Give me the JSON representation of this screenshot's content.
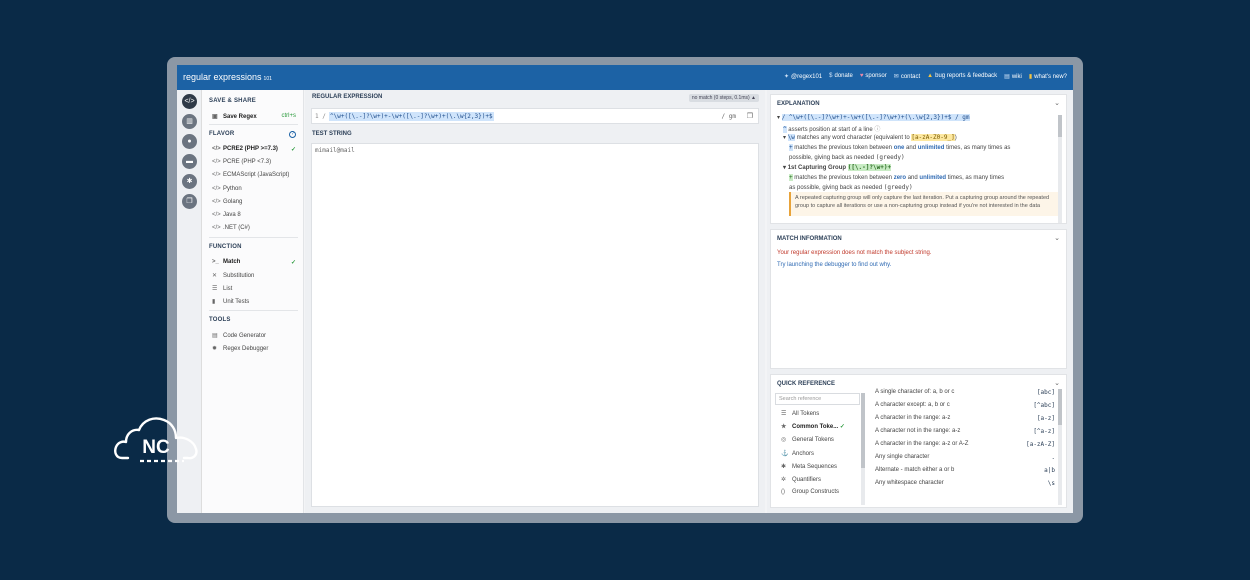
{
  "app": {
    "name": "regular expressions",
    "version": "101"
  },
  "topnav": [
    {
      "icon": "twitter-icon",
      "label": "@regex101"
    },
    {
      "icon": "dollar-icon",
      "label": "donate"
    },
    {
      "icon": "heart-icon",
      "label": "sponsor"
    },
    {
      "icon": "mail-icon",
      "label": "contact"
    },
    {
      "icon": "warning-icon",
      "label": "bug reports & feedback"
    },
    {
      "icon": "book-icon",
      "label": "wiki"
    },
    {
      "icon": "file-icon",
      "label": "what's new?"
    }
  ],
  "sidebar": {
    "save_share_heading": "SAVE & SHARE",
    "save_regex": "Save Regex",
    "save_shortcut": "ctrl+s",
    "flavor_heading": "FLAVOR",
    "flavors": [
      "PCRE2 (PHP >=7.3)",
      "PCRE (PHP <7.3)",
      "ECMAScript (JavaScript)",
      "Python",
      "Golang",
      "Java 8",
      ".NET (C#)"
    ],
    "function_heading": "FUNCTION",
    "functions": [
      "Match",
      "Substitution",
      "List",
      "Unit Tests"
    ],
    "tools_heading": "TOOLS",
    "tools": [
      "Code Generator",
      "Regex Debugger"
    ]
  },
  "editor": {
    "regex_label": "REGULAR EXPRESSION",
    "status": "no match (0 steps, 0.1ms)",
    "regex_prefix": "1 /",
    "regex": "^\\w+([\\.-]?\\w+)+-\\w+([\\.-]?\\w+)+(\\.\\w{2,3})+$",
    "flags": "/ gm",
    "test_label": "TEST STRING",
    "test_string": "mimail@mail"
  },
  "explanation": {
    "heading": "EXPLANATION",
    "regex_line": "/ ^\\w+([\\.-]?\\w+)+-\\w+([\\.-]?\\w+)+(\\.\\w{2,3})+$ / gm",
    "line1": "asserts position at start of a line",
    "line2_token": "\\w",
    "line2": "matches any word character (equivalent to",
    "line2_class": "[a-zA-Z0-9_]",
    "line3_token": "+",
    "line3a": "matches the previous token between",
    "line3_one": "one",
    "line3_and": "and",
    "line3_unl": "unlimited",
    "line3b": "times, as many times as",
    "line3c": "possible, giving back as needed",
    "line3_greedy": "(greedy)",
    "group_label": "1st Capturing Group",
    "group_token": "([\\.-]?\\w+)+",
    "line4_token": "+",
    "line4a": "matches the previous token between",
    "line4_zero": "zero",
    "line4b": "times, as many times",
    "line4c": "as possible, giving back as needed",
    "warning": "A repeated capturing group will only capture the last iteration. Put a capturing group around the repeated group to capture all iterations or use a non-capturing group instead if you're not interested in the data"
  },
  "match_info": {
    "heading": "MATCH INFORMATION",
    "error": "Your regular expression does not match the subject string.",
    "hint": "Try launching the debugger to find out why."
  },
  "quick_ref": {
    "heading": "QUICK REFERENCE",
    "search_placeholder": "Search reference",
    "categories": [
      {
        "icon": "list-icon",
        "label": "All Tokens"
      },
      {
        "icon": "star-icon",
        "label": "Common Toke..."
      },
      {
        "icon": "circle-icon",
        "label": "General Tokens"
      },
      {
        "icon": "anchor-icon",
        "label": "Anchors"
      },
      {
        "icon": "asterisk-icon",
        "label": "Meta Sequences"
      },
      {
        "icon": "quantifier-icon",
        "label": "Quantifiers"
      },
      {
        "icon": "braces-icon",
        "label": "Group Constructs"
      }
    ],
    "rows": [
      {
        "desc": "A single character of: a, b or c",
        "token": "[abc]"
      },
      {
        "desc": "A character except: a, b or c",
        "token": "[^abc]"
      },
      {
        "desc": "A character in the range: a-z",
        "token": "[a-z]"
      },
      {
        "desc": "A character not in the range: a-z",
        "token": "[^a-z]"
      },
      {
        "desc": "A character in the range: a-z or A-Z",
        "token": "[a-zA-Z]"
      },
      {
        "desc": "Any single character",
        "token": "."
      },
      {
        "desc": "Alternate - match either a or b",
        "token": "a|b"
      },
      {
        "desc": "Any whitespace character",
        "token": "\\s"
      }
    ]
  },
  "logo": {
    "text": "NC"
  },
  "colors": {
    "topbar": "#1c62a5",
    "background": "#0a2a47",
    "match_ok": "#2a9a3c",
    "error": "#c0392b"
  }
}
